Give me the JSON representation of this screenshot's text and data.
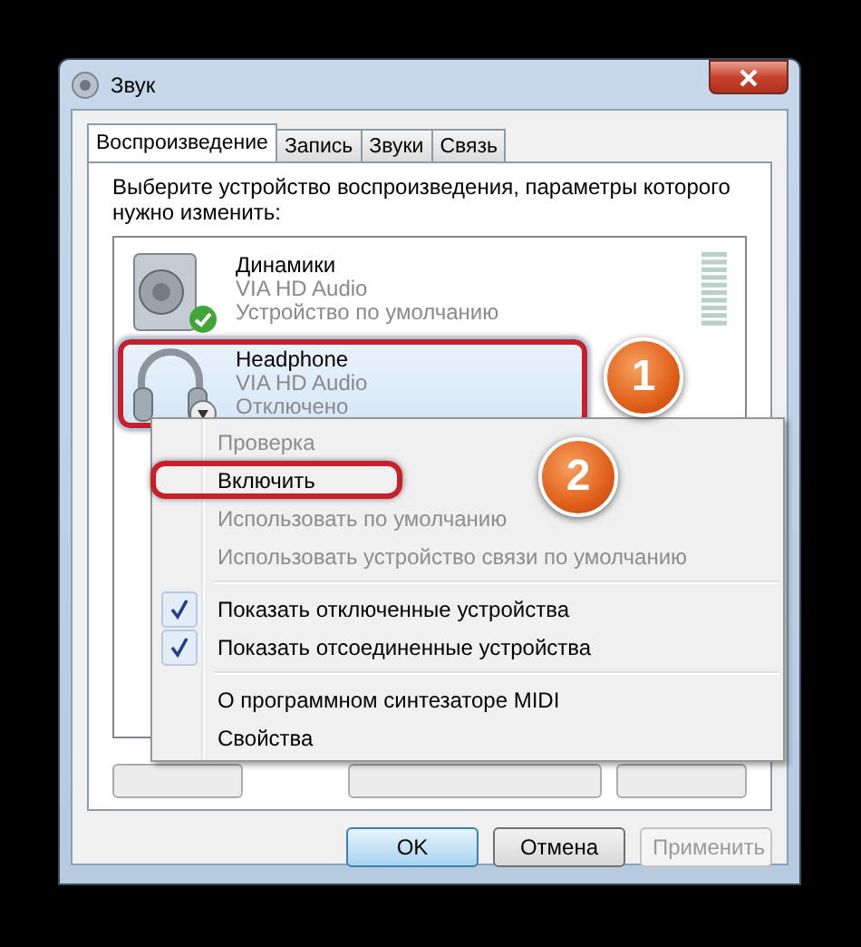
{
  "window": {
    "title": "Звук"
  },
  "tabs": [
    {
      "label": "Воспроизведение",
      "selected": true
    },
    {
      "label": "Запись",
      "selected": false
    },
    {
      "label": "Звуки",
      "selected": false
    },
    {
      "label": "Связь",
      "selected": false
    }
  ],
  "instruction": "Выберите устройство воспроизведения, параметры которого нужно изменить:",
  "devices": [
    {
      "name": "Динамики",
      "driver": "VIA HD Audio",
      "status": "Устройство по умолчанию",
      "kind": "speaker",
      "is_default": true,
      "enabled": true,
      "selected": false,
      "annotated": false
    },
    {
      "name": "Headphone",
      "driver": "VIA HD Audio",
      "status": "Отключено",
      "kind": "headphone",
      "is_default": false,
      "enabled": false,
      "selected": true,
      "annotated": true
    }
  ],
  "context_menu": [
    {
      "kind": "item",
      "label": "Проверка",
      "disabled": true,
      "checked": false,
      "annotated": false
    },
    {
      "kind": "item",
      "label": "Включить",
      "disabled": false,
      "checked": false,
      "annotated": true
    },
    {
      "kind": "item",
      "label": "Использовать по умолчанию",
      "disabled": true,
      "checked": false,
      "annotated": false
    },
    {
      "kind": "item",
      "label": "Использовать устройство связи по умолчанию",
      "disabled": true,
      "checked": false,
      "annotated": false
    },
    {
      "kind": "separator"
    },
    {
      "kind": "item",
      "label": "Показать отключенные устройства",
      "disabled": false,
      "checked": true,
      "annotated": false
    },
    {
      "kind": "item",
      "label": "Показать отсоединенные устройства",
      "disabled": false,
      "checked": true,
      "annotated": false
    },
    {
      "kind": "separator"
    },
    {
      "kind": "item",
      "label": "О программном синтезаторе MIDI",
      "disabled": false,
      "checked": false,
      "annotated": false
    },
    {
      "kind": "item",
      "label": "Свойства",
      "disabled": false,
      "checked": false,
      "annotated": false
    }
  ],
  "callouts": [
    {
      "label": "1"
    },
    {
      "label": "2"
    }
  ],
  "buttons": [
    {
      "label": "OK",
      "default": true,
      "disabled": false
    },
    {
      "label": "Отмена",
      "default": false,
      "disabled": false
    },
    {
      "label": "Применить",
      "default": false,
      "disabled": true
    }
  ]
}
